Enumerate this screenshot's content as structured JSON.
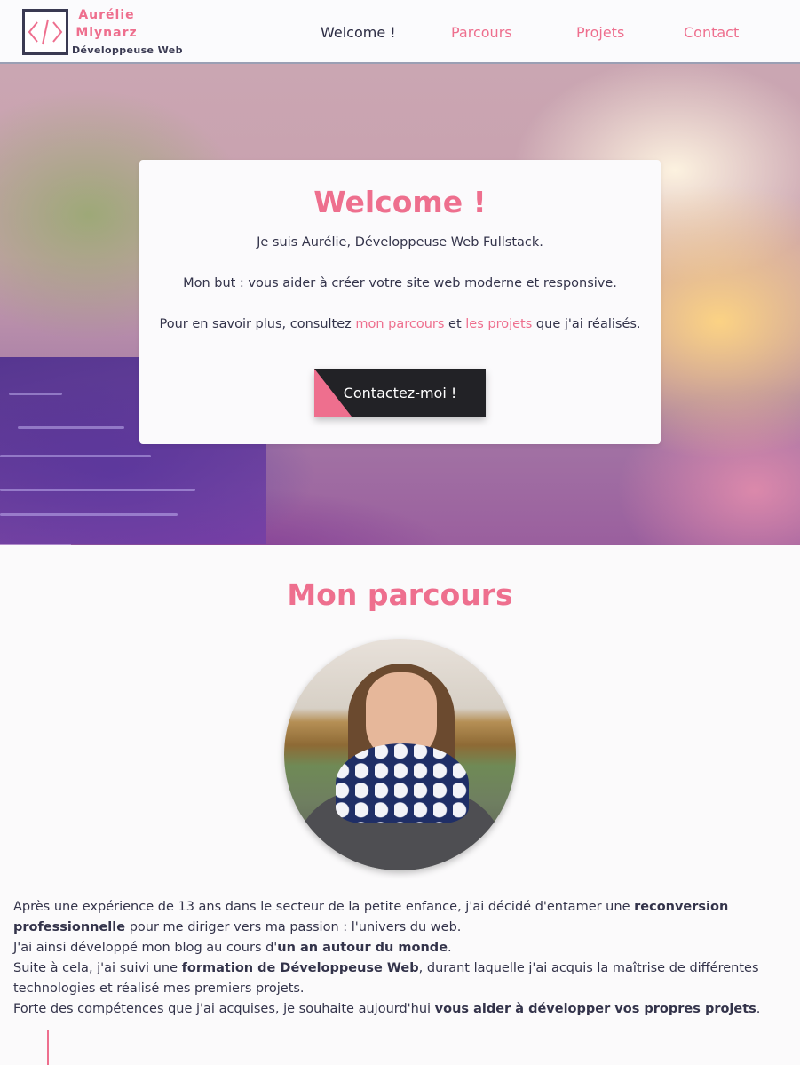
{
  "header": {
    "brand_first": "Aurélie",
    "brand_last": "Mlynarz",
    "brand_sub": "Développeuse Web",
    "nav": [
      {
        "label": "Welcome !",
        "active": true
      },
      {
        "label": "Parcours",
        "active": false
      },
      {
        "label": "Projets",
        "active": false
      },
      {
        "label": "Contact",
        "active": false
      }
    ]
  },
  "hero": {
    "title": "Welcome !",
    "line1": "Je suis Aurélie, Développeuse Web Fullstack.",
    "line2": "Mon but : vous aider à créer votre site web moderne et responsive.",
    "line3_pre": "Pour en savoir plus, consultez ",
    "line3_link1": "mon parcours",
    "line3_mid": " et ",
    "line3_link2": "les projets",
    "line3_post": " que j'ai réalisés.",
    "cta": "Contactez-moi !"
  },
  "parcours": {
    "title": "Mon parcours",
    "bio": {
      "p1_a": "Après une expérience de 13 ans dans le secteur de la petite enfance, j'ai décidé d'entamer une ",
      "p1_b": "reconversion professionnelle",
      "p1_c": " pour me diriger vers ma passion : l'univers du web.",
      "p2_a": "J'ai ainsi développé mon blog au cours d'",
      "p2_b": "un an autour du monde",
      "p2_c": ".",
      "p3_a": "Suite à cela, j'ai suivi une ",
      "p3_b": "formation de Développeuse Web",
      "p3_c": ", durant laquelle j'ai acquis la maîtrise de différentes technologies et réalisé mes premiers projets.",
      "p4_a": "Forte des compétences que j'ai acquises, je souhaite aujourd'hui ",
      "p4_b": "vous aider à développer vos propres projets",
      "p4_c": "."
    }
  },
  "colors": {
    "accent": "#ee6f8e",
    "dark": "#222226",
    "text": "#33334a"
  }
}
